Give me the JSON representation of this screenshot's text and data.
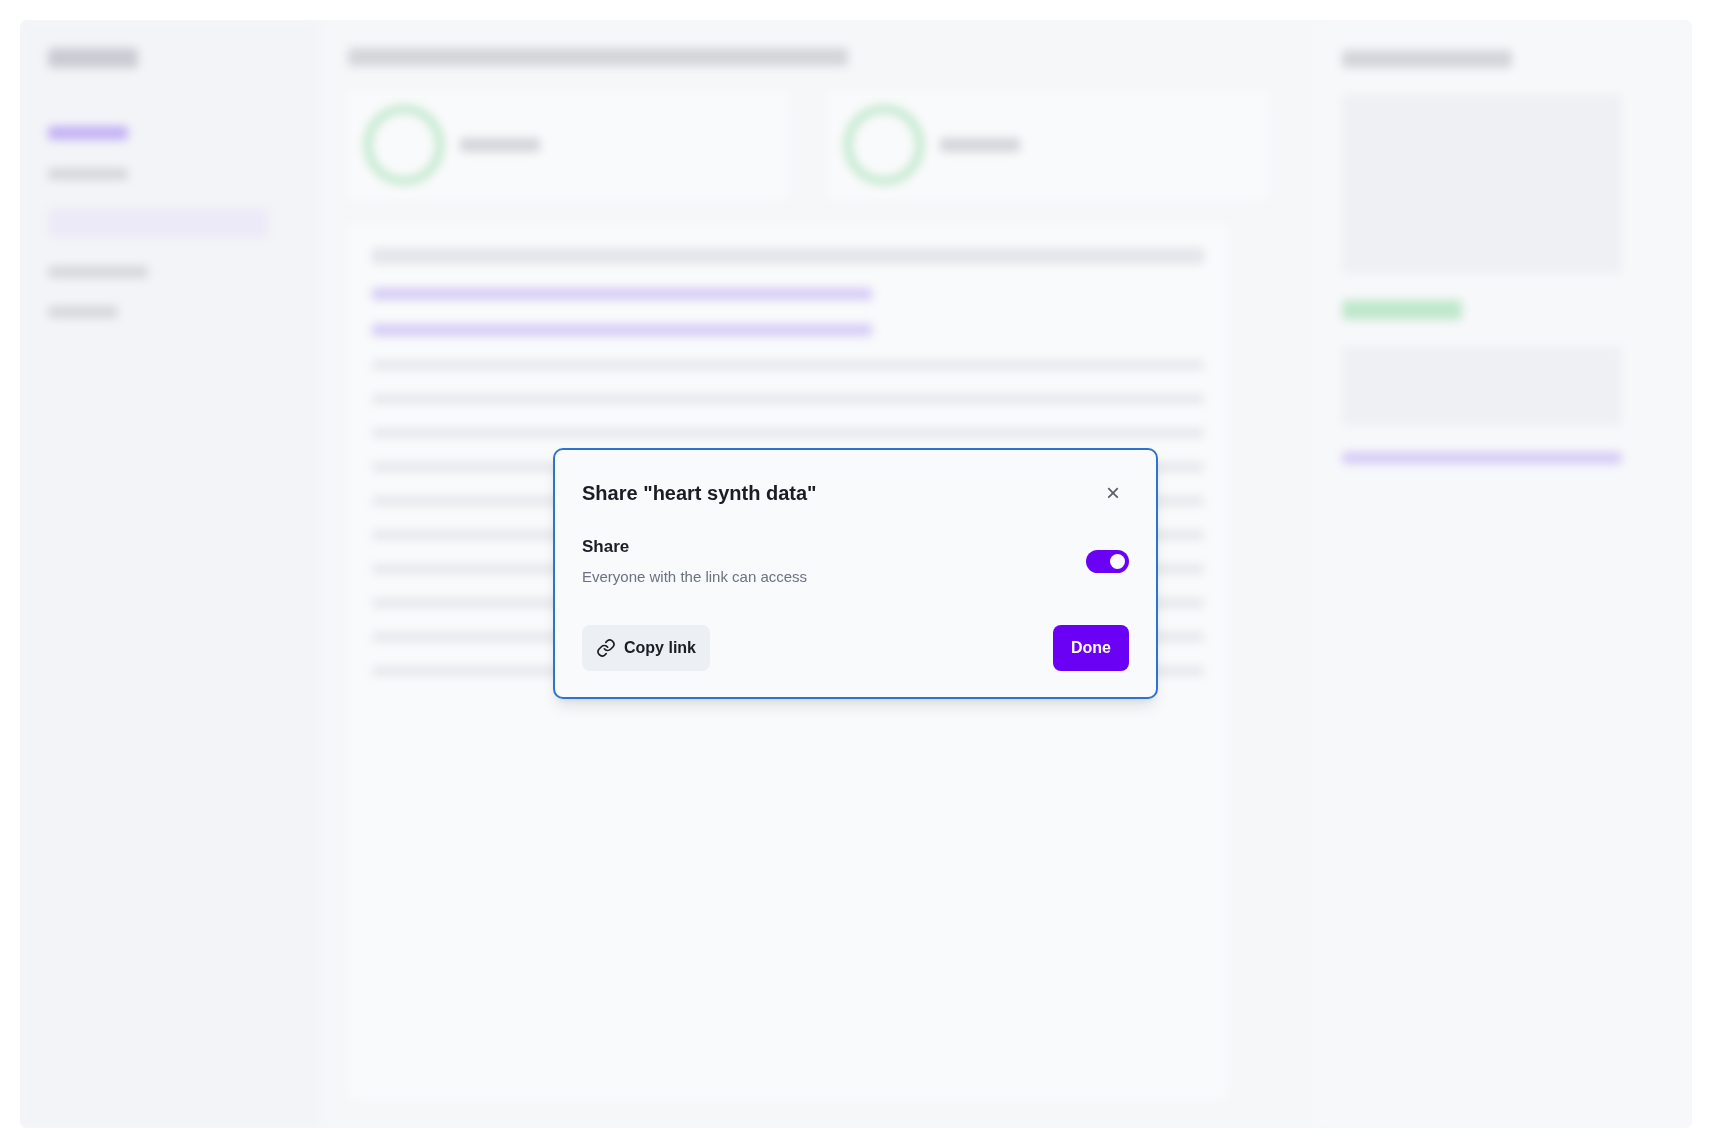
{
  "dialog": {
    "title": "Share \"heart synth data\"",
    "close": "×",
    "setting": {
      "label": "Share",
      "description": "Everyone with the link can access",
      "on": true
    },
    "buttons": [
      {
        "kind": "secondary",
        "label": "Copy link"
      },
      {
        "kind": "primary",
        "label": "Done"
      }
    ]
  }
}
